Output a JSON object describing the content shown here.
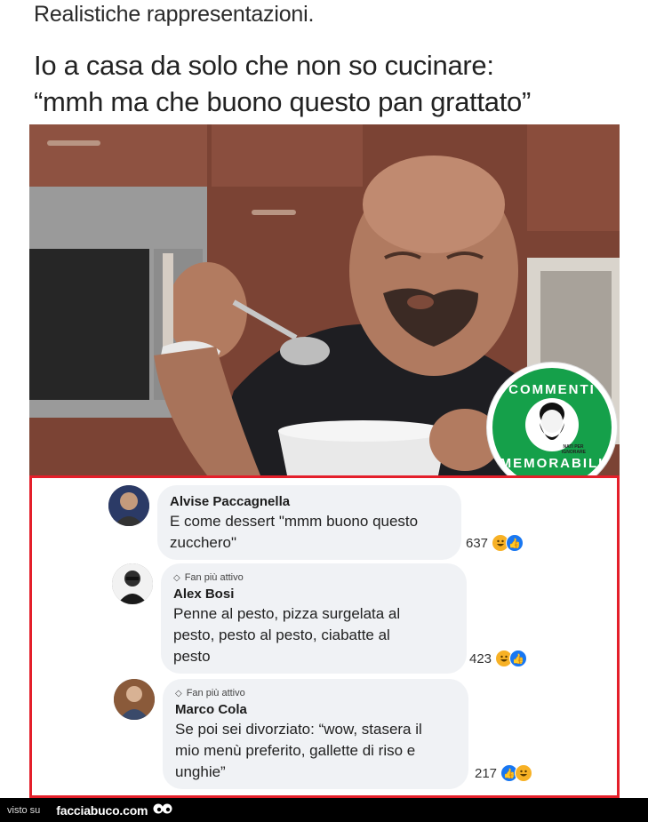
{
  "header": {
    "small_caption": "Realistiche rappresentazioni.",
    "caption_line1": "Io a casa da solo che non so cucinare:",
    "caption_line2": "“mmh ma che buono questo pan grattato”"
  },
  "badge": {
    "top_text": "COMMENTI",
    "bottom_text": "MEMORABILI",
    "small_text": "NATI PER IGNORARE"
  },
  "comments": [
    {
      "author": "Alvise Paccagnella",
      "fan_label": "",
      "text": "E come dessert \"mmm buono questo\nzucchero\"",
      "count": "637",
      "reactions": [
        "haha",
        "like"
      ]
    },
    {
      "author": "Alex Bosi",
      "fan_label": "Fan più attivo",
      "text": "Penne al pesto, pizza surgelata al\npesto, pesto al pesto, ciabatte al\npesto",
      "count": "423",
      "reactions": [
        "haha",
        "like"
      ]
    },
    {
      "author": "Marco Cola",
      "fan_label": "Fan più attivo",
      "text": "Se poi sei divorziato: “wow, stasera il\nmio menù preferito, gallette di riso e\nunghie”",
      "count": "217",
      "reactions": [
        "like",
        "haha"
      ]
    }
  ],
  "footer": {
    "prefix": "visto su",
    "site": "facciabuco.com"
  },
  "colors": {
    "frame": "#e41f2a",
    "badge_green": "#15a04a",
    "bubble": "#f0f2f5",
    "like_blue": "#1877f2",
    "haha_yellow": "#f7b125"
  }
}
